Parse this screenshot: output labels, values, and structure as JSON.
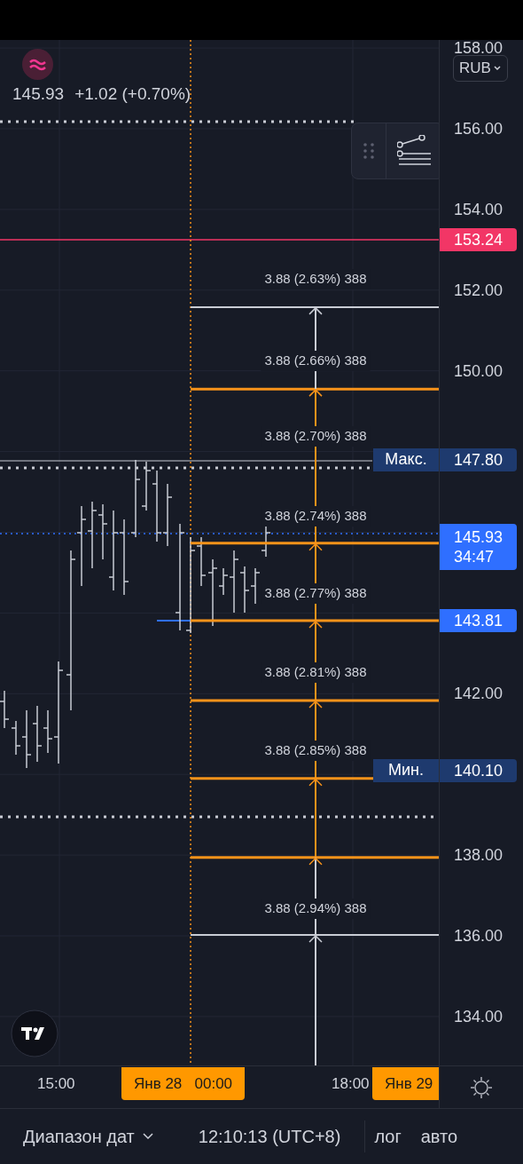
{
  "legend": {
    "price": "145.93",
    "change": "+1.02 (+0.70%)"
  },
  "currency": {
    "label": "RUB"
  },
  "price_axis": {
    "ticks": [
      "158.00",
      "156.00",
      "154.00",
      "152.00",
      "150.00",
      "142.00",
      "138.00",
      "136.00",
      "134.00"
    ]
  },
  "badges": [
    {
      "kind": "alert",
      "value": "153.24"
    },
    {
      "kind": "max",
      "label": "Макс.",
      "value": "147.80"
    },
    {
      "kind": "last",
      "value": "145.93",
      "countdown": "34:47"
    },
    {
      "kind": "level",
      "value": "143.81"
    },
    {
      "kind": "min",
      "label": "Мин.",
      "value": "140.10"
    }
  ],
  "measure": {
    "labels": [
      "3.88 (2.63%) 388",
      "3.88 (2.66%) 388",
      "3.88 (2.70%) 388",
      "3.88 (2.74%) 388",
      "3.88 (2.77%) 388",
      "3.88 (2.81%) 388",
      "3.88 (2.85%) 388",
      "3.88 (2.94%) 388"
    ],
    "lines": [
      {
        "kind": "outer"
      },
      {
        "kind": "inner"
      },
      {
        "kind": "inner"
      },
      {
        "kind": "inner"
      },
      {
        "kind": "inner"
      },
      {
        "kind": "inner"
      },
      {
        "kind": "inner"
      },
      {
        "kind": "outer"
      }
    ]
  },
  "time_axis": {
    "labels": [
      {
        "text": "15:00",
        "highlighted": false
      },
      {
        "text": "Янв 28   00:00",
        "highlighted": true
      },
      {
        "text": "18:00",
        "highlighted": false
      },
      {
        "text": "Янв 29",
        "highlighted": true
      }
    ]
  },
  "bottom_bar": {
    "range": "Диапазон дат",
    "clock": "12:10:13 (UTC+8)",
    "log": "лог",
    "auto": "авто"
  }
}
